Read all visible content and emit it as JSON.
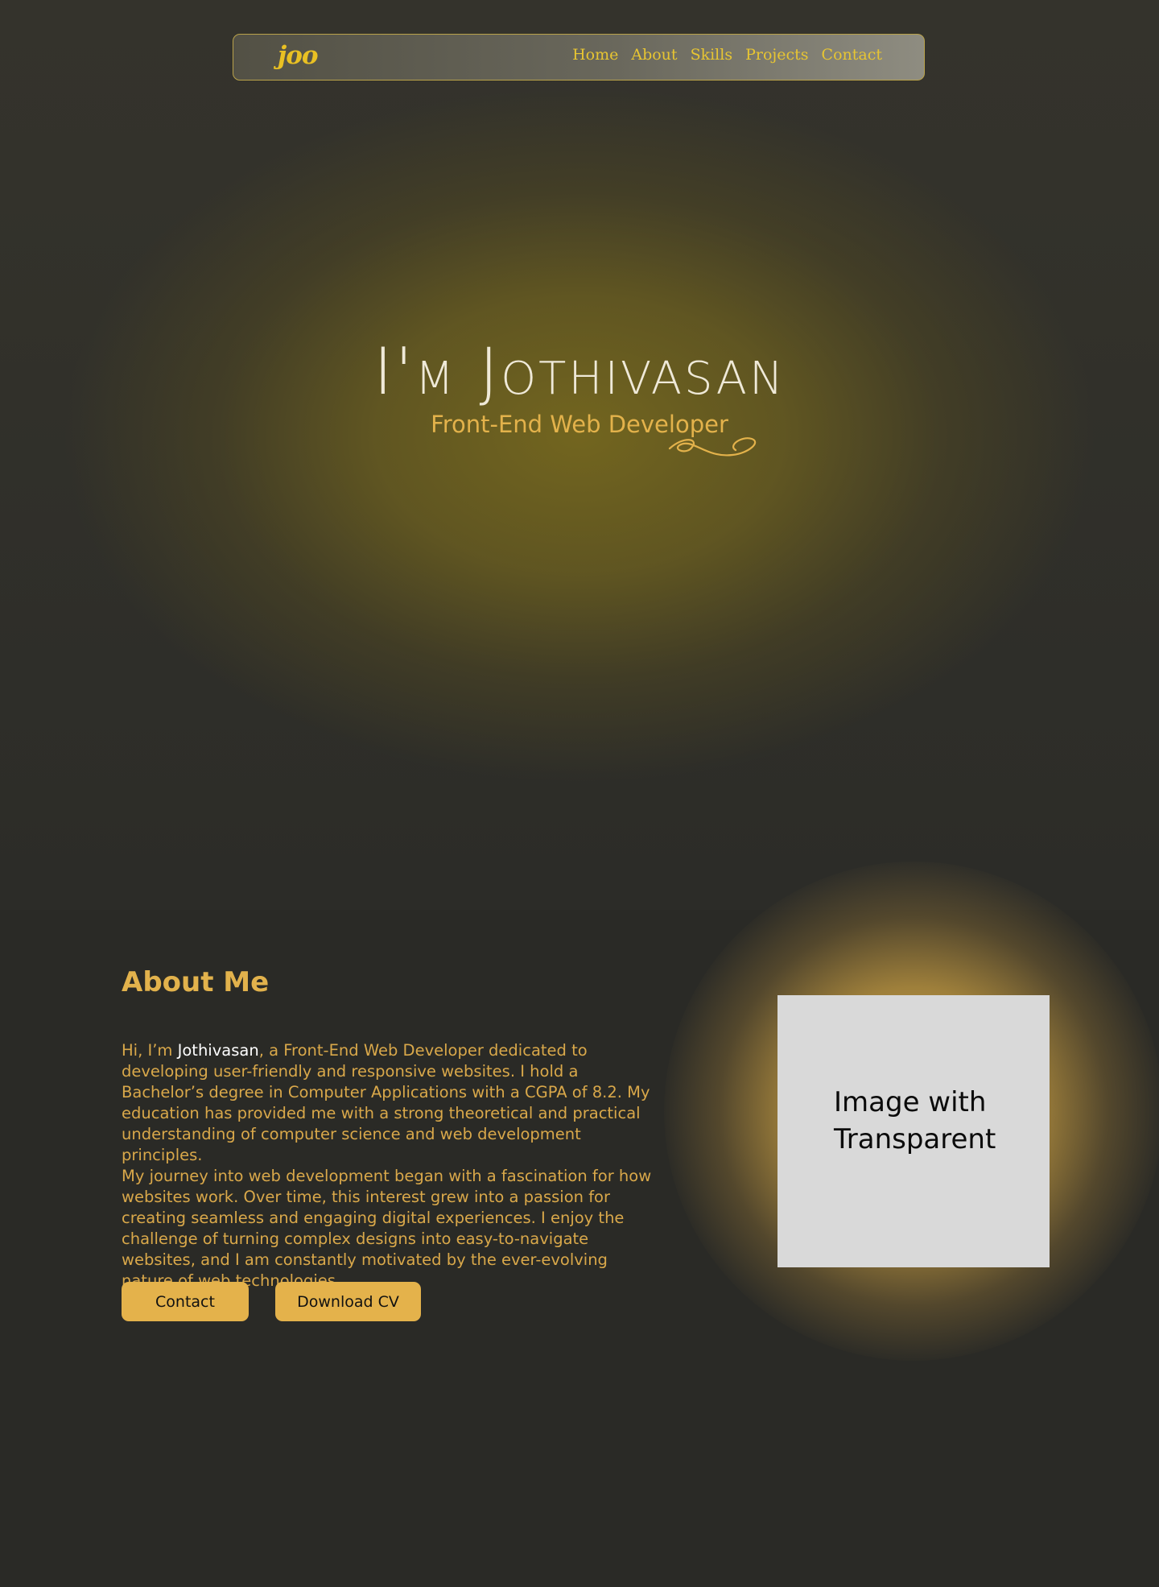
{
  "navbar": {
    "logo": "joo",
    "links": [
      "Home",
      "About",
      "Skills",
      "Projects",
      "Contact"
    ]
  },
  "hero": {
    "title": "I'm Jothivasan",
    "subtitle": "Front-End Web Developer"
  },
  "about": {
    "heading": "About Me",
    "intro_prefix": "Hi, I’m ",
    "name": "Jothivasan",
    "paragraph1_rest": ", a Front-End Web Developer dedicated to developing user-friendly and responsive websites. I hold a Bachelor’s degree in Computer Applications with a CGPA of 8.2. My education has provided me with a strong theoretical and practical understanding of computer science and web development principles.",
    "paragraph2": "My journey into web development began with a fascination for how websites work. Over time, this interest grew into a passion for creating seamless and engaging digital experiences. I enjoy the challenge of turning complex designs into easy-to-navigate websites, and I am constantly motivated by the ever-evolving nature of web technologies.",
    "buttons": {
      "contact": "Contact",
      "download_cv": "Download CV"
    },
    "image_caption": "Image with Transparent"
  },
  "colors": {
    "accent": "#e4b24b",
    "nav_text": "#e7c532",
    "background": "#2a2a26"
  }
}
